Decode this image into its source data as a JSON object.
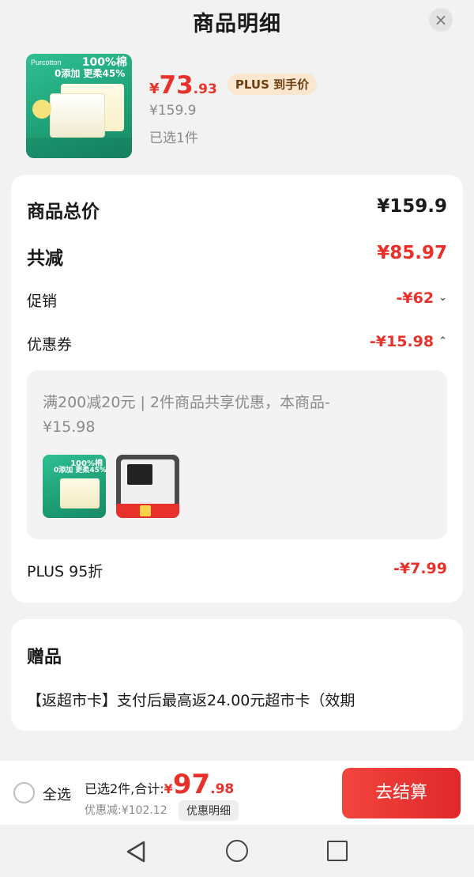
{
  "header": {
    "title": "商品明细",
    "close_label": "×"
  },
  "product": {
    "thumb": {
      "brand": "Purcotton",
      "badge": "100%棉",
      "slogan": "0添加 更柔45%"
    },
    "price_symbol": "¥",
    "price_int": "73",
    "price_dec": ".93",
    "plus_tag": "PLUS 到手价",
    "original_price": "¥159.9",
    "quantity": "已选1件"
  },
  "summary": {
    "total_label": "商品总价",
    "total_value": "¥159.9",
    "reduce_label": "共减",
    "reduce_value": "¥85.97",
    "promo_label": "促销",
    "promo_value": "-¥62",
    "coupon_label": "优惠券",
    "coupon_value": "-¥15.98",
    "coupon_detail": "满200减20元 | 2件商品共享优惠，本商品-¥15.98",
    "coupon_thumb1": {
      "badge": "100%棉",
      "slogan": "0添加 更柔45%"
    },
    "plus_label": "PLUS 95折",
    "plus_value": "-¥7.99"
  },
  "gift": {
    "title": "赠品",
    "text": "【返超市卡】支付后最高返24.00元超市卡（效期"
  },
  "footer": {
    "select_all": "全选",
    "sum_label": "已选2件,合计:",
    "sum_symbol": "¥",
    "sum_int": "97",
    "sum_dec": ".98",
    "discount_text": "优惠减:¥102.12",
    "detail_button": "优惠明细",
    "checkout_button": "去结算"
  },
  "icons": {
    "close": "close-icon",
    "chevron_down": "chevron-down-icon",
    "chevron_up": "chevron-up-icon",
    "back": "back-icon",
    "home": "home-icon",
    "recent": "recent-apps-icon"
  },
  "colors": {
    "accent_red": "#e8312a",
    "plus_tag_bg": "#fbe6cf",
    "plus_tag_text": "#6b3f12"
  }
}
